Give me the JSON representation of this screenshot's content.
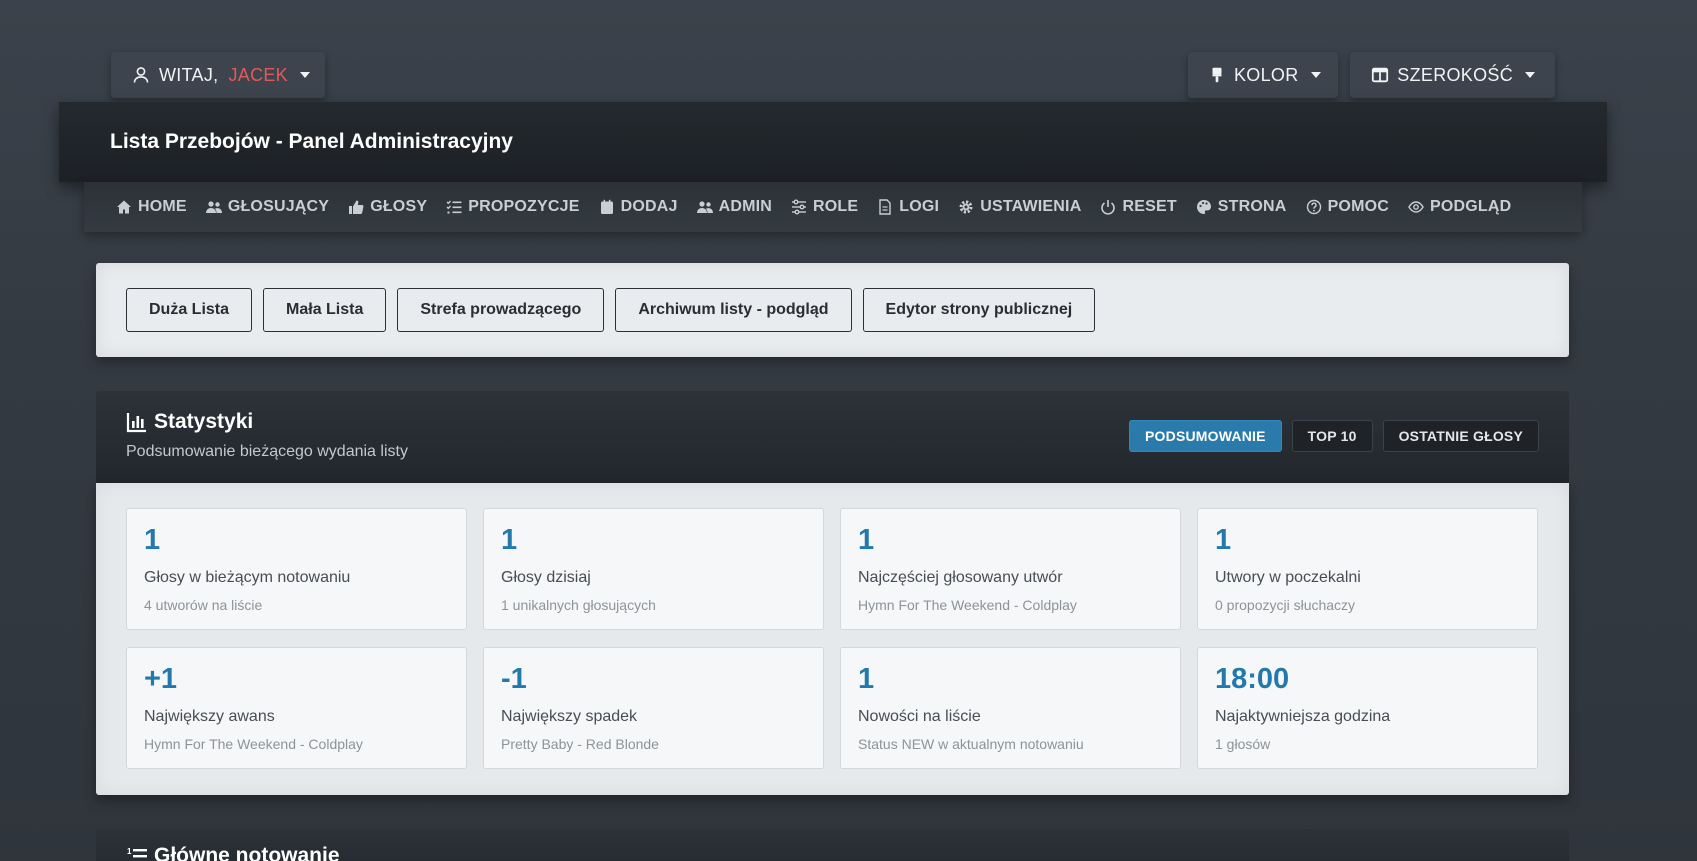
{
  "topbar": {
    "user": {
      "greeting": "WITAJ,",
      "name": "JACEK",
      "icon": "user-icon"
    },
    "color": {
      "label": "KOLOR",
      "icon": "paint-brush-icon"
    },
    "width": {
      "label": "SZEROKOŚĆ",
      "icon": "columns-icon"
    }
  },
  "header": {
    "title": "Lista Przebojów - Panel Administracyjny"
  },
  "nav": {
    "items": [
      {
        "label": "HOME",
        "icon": "home-icon"
      },
      {
        "label": "GŁOSUJĄCY",
        "icon": "users-icon"
      },
      {
        "label": "GŁOSY",
        "icon": "thumbs-up-icon"
      },
      {
        "label": "PROPOZYCJE",
        "icon": "list-check-icon"
      },
      {
        "label": "DODAJ",
        "icon": "calendar-icon"
      },
      {
        "label": "ADMIN",
        "icon": "users-cog-icon"
      },
      {
        "label": "ROLE",
        "icon": "sliders-icon"
      },
      {
        "label": "LOGI",
        "icon": "file-icon"
      },
      {
        "label": "USTAWIENIA",
        "icon": "gear-icon"
      },
      {
        "label": "RESET",
        "icon": "power-icon"
      },
      {
        "label": "STRONA",
        "icon": "palette-icon"
      },
      {
        "label": "POMOC",
        "icon": "question-icon"
      },
      {
        "label": "PODGLĄD",
        "icon": "eye-icon"
      }
    ]
  },
  "quick_links": [
    "Duża Lista",
    "Mała Lista",
    "Strefa prowadzącego",
    "Archiwum listy - podgląd",
    "Edytor strony publicznej"
  ],
  "stats": {
    "title": "Statystyki",
    "subtitle": "Podsumowanie bieżącego wydania listy",
    "tabs": [
      {
        "label": "PODSUMOWANIE",
        "active": true
      },
      {
        "label": "TOP 10",
        "active": false
      },
      {
        "label": "OSTATNIE GŁOSY",
        "active": false
      }
    ],
    "cards": [
      {
        "value": "1",
        "label": "Głosy w bieżącym notowaniu",
        "sub": "4 utworów na liście"
      },
      {
        "value": "1",
        "label": "Głosy dzisiaj",
        "sub": "1 unikalnych głosujących"
      },
      {
        "value": "1",
        "label": "Najczęściej głosowany utwór",
        "sub": "Hymn For The Weekend - Coldplay"
      },
      {
        "value": "1",
        "label": "Utwory w poczekalni",
        "sub": "0 propozycji słuchaczy"
      },
      {
        "value": "+1",
        "label": "Największy awans",
        "sub": "Hymn For The Weekend - Coldplay"
      },
      {
        "value": "-1",
        "label": "Największy spadek",
        "sub": "Pretty Baby - Red Blonde"
      },
      {
        "value": "1",
        "label": "Nowości na liście",
        "sub": "Status NEW w aktualnym notowaniu"
      },
      {
        "value": "18:00",
        "label": "Najaktywniejsza godzina",
        "sub": "1 głosów"
      }
    ]
  },
  "main_chart": {
    "title": "Główne notowanie"
  },
  "colors": {
    "accent": "#2a7bab",
    "username": "#e15a5a",
    "value": "#2379ab"
  }
}
